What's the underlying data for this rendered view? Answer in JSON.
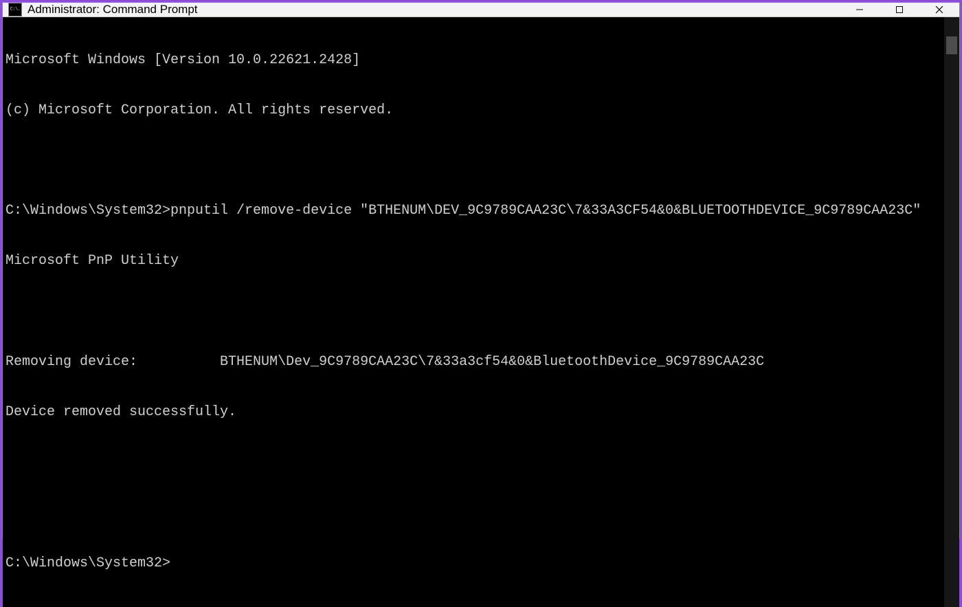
{
  "window": {
    "title": "Administrator: Command Prompt",
    "icon_text": "C:\\."
  },
  "terminal": {
    "lines": [
      "Microsoft Windows [Version 10.0.22621.2428]",
      "(c) Microsoft Corporation. All rights reserved.",
      "",
      "C:\\Windows\\System32>pnputil /remove-device \"BTHENUM\\DEV_9C9789CAA23C\\7&33A3CF54&0&BLUETOOTHDEVICE_9C9789CAA23C\"",
      "Microsoft PnP Utility",
      "",
      "Removing device:          BTHENUM\\Dev_9C9789CAA23C\\7&33a3cf54&0&BluetoothDevice_9C9789CAA23C",
      "Device removed successfully.",
      "",
      "",
      "C:\\Windows\\System32>"
    ]
  }
}
